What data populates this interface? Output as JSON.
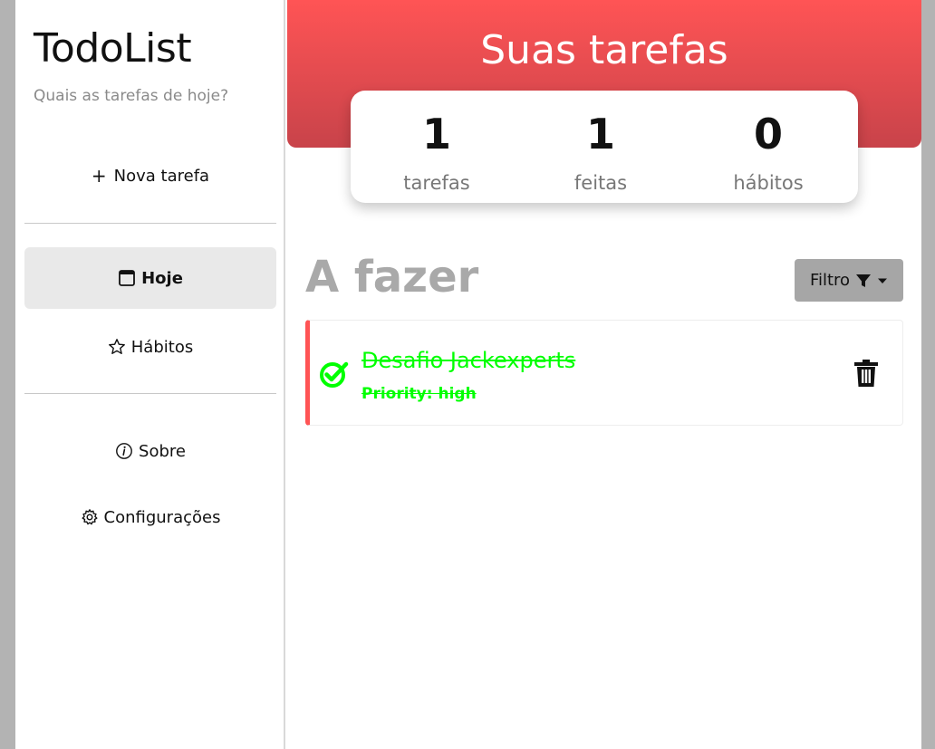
{
  "sidebar": {
    "title": "TodoList",
    "subtitle": "Quais as tarefas de hoje?",
    "new_task": {
      "icon": "plus-icon",
      "label": "Nova tarefa"
    },
    "nav": [
      {
        "label": "Hoje",
        "icon": "calendar-icon",
        "active": true
      },
      {
        "label": "Hábitos",
        "icon": "star-icon",
        "active": false
      },
      {
        "label": "Sobre",
        "icon": "info-icon",
        "active": false
      },
      {
        "label": "Configurações",
        "icon": "gear-icon",
        "active": false
      }
    ]
  },
  "header": {
    "title": "Suas tarefas",
    "stats": [
      {
        "value": "1",
        "label": "tarefas"
      },
      {
        "value": "1",
        "label": "feitas"
      },
      {
        "value": "0",
        "label": "hábitos"
      }
    ]
  },
  "main": {
    "section_title": "A fazer",
    "filter": {
      "label": "Filtro",
      "icon": "filter-icon"
    },
    "tasks": [
      {
        "title": "Desafio Jackexperts",
        "priority": "Priority: high",
        "done": true
      }
    ]
  },
  "colors": {
    "accent": "#ff5455",
    "banner_bottom": "#c8434a",
    "done_green": "#00ff00",
    "filter_bg": "#a6a6a6",
    "section_title": "#a9a9a9"
  }
}
